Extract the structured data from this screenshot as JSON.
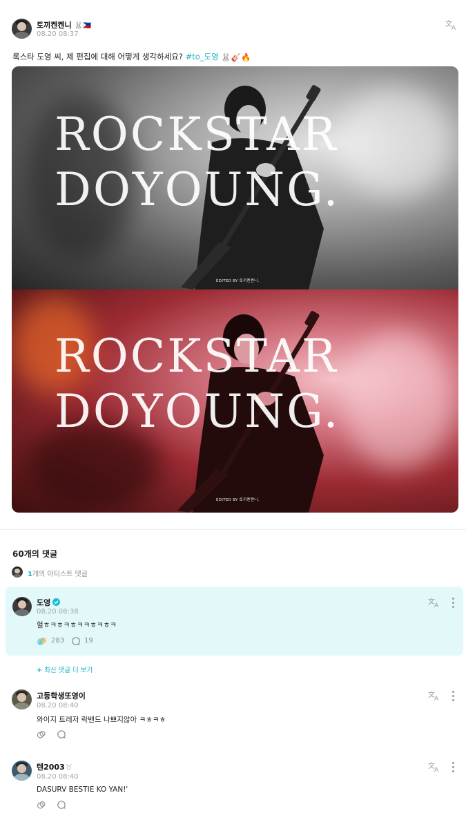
{
  "post": {
    "author": "토끼켄켄니",
    "author_emojis": "🐰🇵🇭",
    "timestamp": "08.20 08:37",
    "text_before": "록스타 도영 씨, 제 편집에 대해 어떻게 생각하세요?",
    "hashtag": "#to_도영",
    "text_emojis": "🐰🎸🔥",
    "image": {
      "panels": [
        {
          "line1": "ROCKSTAR",
          "line2": "DOYOUNG.",
          "credit": "EDITED BY 토끼켄켄니."
        },
        {
          "line1": "ROCKSTAR",
          "line2": "DOYOUNG.",
          "credit": "EDITED BY 토끼켄켄니."
        }
      ]
    }
  },
  "comments_section": {
    "title": "60개의 댓글",
    "artist_count": "1",
    "artist_label": "개의 아티스트 댓글",
    "more_latest": "최신 댓글 더 보기"
  },
  "artist_comment": {
    "author": "도영",
    "timestamp": "08.20 08:38",
    "text": "헐ㅎㅋㅎㅋㅎㅋㅋㅎㅋㅎㅋ",
    "likes": "283",
    "replies": "19"
  },
  "comments": [
    {
      "author": "고등학생또영이",
      "timestamp": "08.20 08:40",
      "text": "와이지 트레저 락밴드 나쁘지않아 ㅋㅎㅋㅎ"
    },
    {
      "author": "텐2003",
      "author_suffix": "♉",
      "timestamp": "08.20 08:40",
      "text": "DASURV BESTIE KO YAN!'"
    }
  ],
  "colors": {
    "accent": "#16b2c4",
    "highlight_bg": "#e3f8f9",
    "muted": "#a4a4a4"
  },
  "icons": [
    "translate-icon",
    "more-icon",
    "like-icon",
    "reply-icon",
    "verified-icon"
  ]
}
